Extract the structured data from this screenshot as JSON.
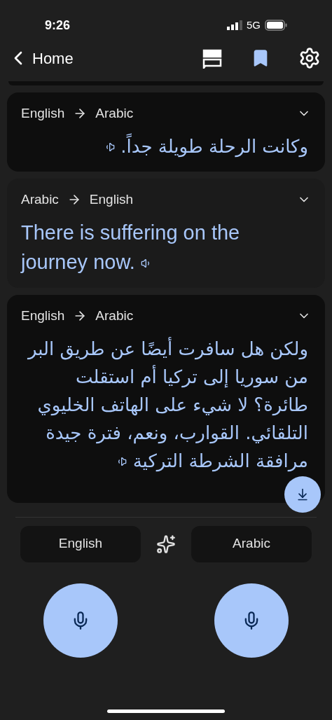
{
  "status_bar": {
    "time": "9:26",
    "network": "5G"
  },
  "nav": {
    "back_label": "Home",
    "bookmark_on": true
  },
  "cards": [
    {
      "kind": "dark",
      "from": "English",
      "to": "Arabic",
      "rtl": true,
      "text": "وكانت الرحلة طويلة جداً."
    },
    {
      "kind": "light",
      "from": "Arabic",
      "to": "English",
      "rtl": false,
      "text": "There is suffering on the journey now."
    },
    {
      "kind": "dark",
      "from": "English",
      "to": "Arabic",
      "rtl": true,
      "text": "ولكن هل سافرت أيضًا عن طريق البر من سوريا إلى تركيا أم استقلت طائرة؟ لا شيء على الهاتف الخليوي التلقائي. القوارب، ونعم، فترة جيدة مرافقة الشرطة التركية"
    }
  ],
  "language_bar": {
    "left_language": "English",
    "right_language": "Arabic"
  }
}
